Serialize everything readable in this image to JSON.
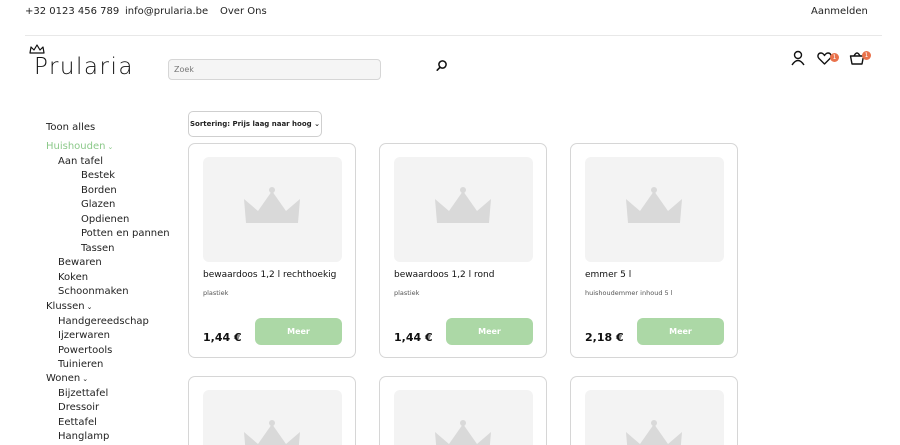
{
  "topbar": {
    "phone": "+32 0123 456 789",
    "email": "info@prularia.be",
    "about": "Over Ons",
    "login": "Aanmelden"
  },
  "header": {
    "logo_text": "Prularia",
    "search_placeholder": "Zoek",
    "wishlist_count": "1",
    "cart_count": "1"
  },
  "sidebar": {
    "show_all": "Toon alles",
    "huishouden": "Huishouden",
    "aan_tafel": "Aan tafel",
    "bestek": "Bestek",
    "borden": "Borden",
    "glazen": "Glazen",
    "opdienen": "Opdienen",
    "potten": "Potten en pannen",
    "tassen": "Tassen",
    "bewaren": "Bewaren",
    "koken": "Koken",
    "schoonmaken": "Schoonmaken",
    "klussen": "Klussen",
    "handgereedschap": "Handgereedschap",
    "ijzerwaren": "Ijzerwaren",
    "powertools": "Powertools",
    "tuinieren": "Tuinieren",
    "wonen": "Wonen",
    "bijzettafel": "Bijzettafel",
    "dressoir": "Dressoir",
    "eettafel": "Eettafel",
    "hanglamp": "Hanglamp"
  },
  "sort": {
    "label": "Sortering: Prijs laag naar hoog"
  },
  "products": [
    {
      "name": "bewaardoos 1,2 l rechthoekig",
      "description": "plastiek",
      "price": "1,44 €",
      "button": "Meer"
    },
    {
      "name": "bewaardoos 1,2 l rond",
      "description": "plastiek",
      "price": "1,44 €",
      "button": "Meer"
    },
    {
      "name": "emmer 5 l",
      "description": "huishoudemmer inhoud 5 l",
      "price": "2,18 €",
      "button": "Meer"
    }
  ],
  "colors": {
    "accent_green": "#8cc98a",
    "button_green": "#acd8a6",
    "badge_orange": "#e9724c"
  }
}
